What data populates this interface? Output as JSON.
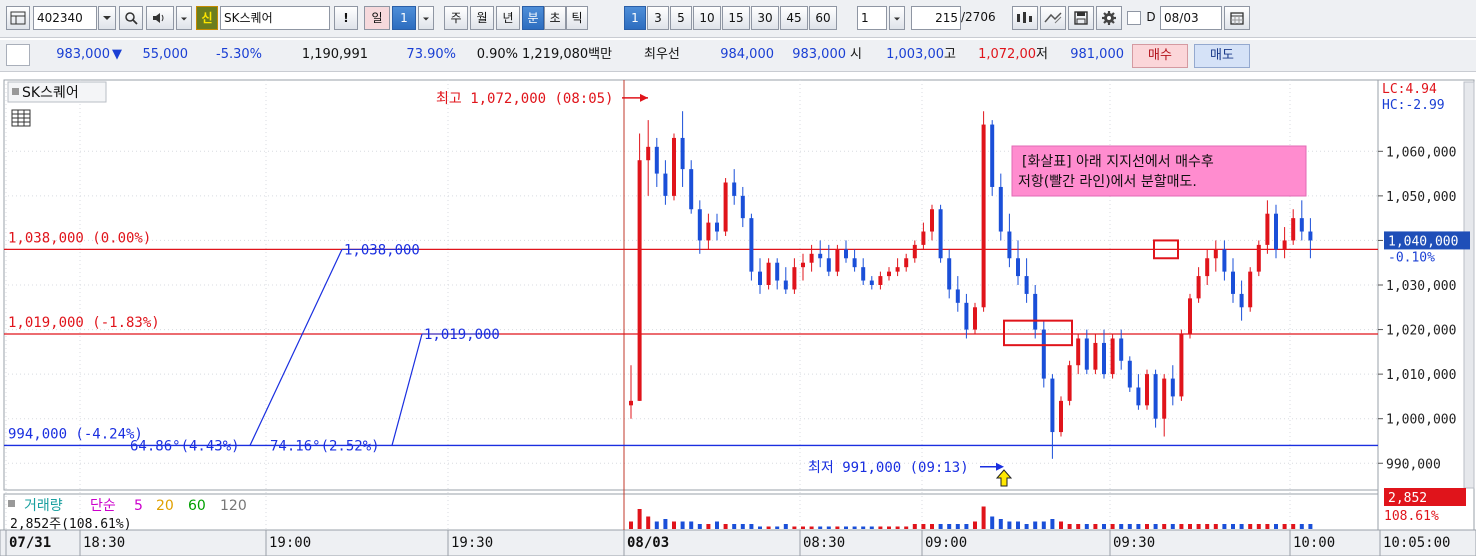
{
  "toolbar": {
    "stock_code": "402340",
    "new_badge": "신",
    "stock_name": "SK스퀘어",
    "exclaim": "!",
    "period_day": "일",
    "period_count": "1",
    "tabs": [
      "주",
      "월",
      "년",
      "분",
      "초",
      "틱"
    ],
    "selected_tab": "분",
    "intervals": [
      "1",
      "3",
      "5",
      "10",
      "15",
      "30",
      "45",
      "60"
    ],
    "selected_interval": "1",
    "interval_value": "1",
    "record_count": "215",
    "record_total": "/2706",
    "date_check_label": "D",
    "date_value": "08/03",
    "icons": [
      "chart-type-icon",
      "search-icon",
      "sound-icon",
      "bar-pattern-icon",
      "crosshair-icon",
      "save-icon",
      "settings-icon",
      "calendar-icon"
    ]
  },
  "quote": {
    "price": "983,000",
    "change_arrow": "▼",
    "change": "55,000",
    "change_pct": "-5.30%",
    "volume": "1,190,991",
    "vol_ratio": "73.90%",
    "turnover": "0.90%",
    "trade_value": "1,219,080백만",
    "best_label": "최우선",
    "best_ask": "984,000",
    "best_bid": "983,000",
    "open_label": "시",
    "open": "1,003,00",
    "high_label": "고",
    "high": "1,072,00",
    "low_label": "저",
    "low": "981,000",
    "buy_button": "매수",
    "sell_button": "매도"
  },
  "chart_data": {
    "type": "candlestick",
    "title": "SK스퀘어",
    "interval": "1분",
    "ylim": [
      984000,
      1076000
    ],
    "y_ticks": [
      990000,
      1000000,
      1010000,
      1020000,
      1030000,
      1040000,
      1050000,
      1060000
    ],
    "y_tick_labels": [
      "990,000",
      "1,000,000",
      "1,010,000",
      "1,020,000",
      "1,030,000",
      "1,040,000",
      "1,050,000",
      "1,060,000"
    ],
    "x_ticks": [
      "07/31",
      "18:30",
      "19:00",
      "19:30",
      "08/03",
      "08:30",
      "09:00",
      "09:30",
      "10:00",
      "10:05:00"
    ],
    "corner_labels": {
      "lc": "LC:4.94",
      "hc": "HC:-2.99"
    },
    "last_price": {
      "value": 1040000,
      "label": "1,040,000",
      "pct": "-0.10%"
    },
    "hlines": [
      {
        "value": 1038000,
        "label": "1,038,000 (0.00%)",
        "color": "#e0141b"
      },
      {
        "value": 1019000,
        "label": "1,019,000 (-1.83%)",
        "color": "#e0141b"
      },
      {
        "value": 994000,
        "label": "994,000 (-4.24%)",
        "color": "#1a2fe0"
      }
    ],
    "trendlines": [
      {
        "value_label": "1,038,000",
        "angle_label": "64.86°(4.43%)"
      },
      {
        "value_label": "1,019,000",
        "angle_label": "74.16°(2.52%)"
      }
    ],
    "annotations": {
      "high_label": "최고 1,072,000 (08:05)",
      "low_label": "최저 991,000 (09:13)",
      "note_line1": "[화살표] 아래 지지선에서 매수후",
      "note_line2": "저항(빨간 라인)에서 분할매도."
    },
    "candles": [
      [
        1003000,
        1012000,
        1000000,
        1004000
      ],
      [
        1004000,
        1064000,
        1004000,
        1058000
      ],
      [
        1058000,
        1067000,
        1050000,
        1061000
      ],
      [
        1061000,
        1063000,
        1052000,
        1055000
      ],
      [
        1055000,
        1058000,
        1048000,
        1050000
      ],
      [
        1050000,
        1064000,
        1049000,
        1063000
      ],
      [
        1063000,
        1069000,
        1052000,
        1056000
      ],
      [
        1056000,
        1058000,
        1046000,
        1047000
      ],
      [
        1047000,
        1049000,
        1037000,
        1040000
      ],
      [
        1040000,
        1046000,
        1038000,
        1044000
      ],
      [
        1044000,
        1046000,
        1040000,
        1042000
      ],
      [
        1042000,
        1054000,
        1041000,
        1053000
      ],
      [
        1053000,
        1056000,
        1048000,
        1050000
      ],
      [
        1050000,
        1052000,
        1043000,
        1045000
      ],
      [
        1045000,
        1046000,
        1031000,
        1033000
      ],
      [
        1033000,
        1036000,
        1028000,
        1030000
      ],
      [
        1030000,
        1036000,
        1029000,
        1035000
      ],
      [
        1035000,
        1036000,
        1029000,
        1031000
      ],
      [
        1031000,
        1034000,
        1028000,
        1029000
      ],
      [
        1029000,
        1036000,
        1028000,
        1034000
      ],
      [
        1034000,
        1037000,
        1031000,
        1035000
      ],
      [
        1035000,
        1039000,
        1033000,
        1037000
      ],
      [
        1037000,
        1040000,
        1034000,
        1036000
      ],
      [
        1036000,
        1039000,
        1032000,
        1033000
      ],
      [
        1033000,
        1039000,
        1032000,
        1038000
      ],
      [
        1038000,
        1040000,
        1035000,
        1036000
      ],
      [
        1036000,
        1038000,
        1033000,
        1034000
      ],
      [
        1034000,
        1036000,
        1030000,
        1031000
      ],
      [
        1031000,
        1032000,
        1029000,
        1030000
      ],
      [
        1030000,
        1033000,
        1029000,
        1032000
      ],
      [
        1032000,
        1034000,
        1031000,
        1033000
      ],
      [
        1033000,
        1036000,
        1032000,
        1034000
      ],
      [
        1034000,
        1037000,
        1033000,
        1036000
      ],
      [
        1036000,
        1040000,
        1035000,
        1039000
      ],
      [
        1039000,
        1044000,
        1038000,
        1042000
      ],
      [
        1042000,
        1048000,
        1040000,
        1047000
      ],
      [
        1047000,
        1048000,
        1035000,
        1036000
      ],
      [
        1036000,
        1038000,
        1027000,
        1029000
      ],
      [
        1029000,
        1032000,
        1024000,
        1026000
      ],
      [
        1026000,
        1028000,
        1018000,
        1020000
      ],
      [
        1020000,
        1026000,
        1019000,
        1025000
      ],
      [
        1025000,
        1069000,
        1024000,
        1066000
      ],
      [
        1066000,
        1067000,
        1050000,
        1052000
      ],
      [
        1052000,
        1055000,
        1040000,
        1042000
      ],
      [
        1042000,
        1046000,
        1034000,
        1036000
      ],
      [
        1036000,
        1040000,
        1030000,
        1032000
      ],
      [
        1032000,
        1036000,
        1026000,
        1028000
      ],
      [
        1028000,
        1030000,
        1018000,
        1020000
      ],
      [
        1020000,
        1022000,
        1007000,
        1009000
      ],
      [
        1009000,
        1010000,
        991000,
        997000
      ],
      [
        997000,
        1005000,
        996000,
        1004000
      ],
      [
        1004000,
        1013000,
        1003000,
        1012000
      ],
      [
        1012000,
        1019000,
        1010000,
        1018000
      ],
      [
        1018000,
        1020000,
        1010000,
        1011000
      ],
      [
        1011000,
        1019000,
        1010000,
        1017000
      ],
      [
        1017000,
        1020000,
        1009000,
        1010000
      ],
      [
        1010000,
        1019000,
        1009000,
        1018000
      ],
      [
        1018000,
        1020000,
        1011000,
        1013000
      ],
      [
        1013000,
        1014000,
        1006000,
        1007000
      ],
      [
        1007000,
        1010000,
        1002000,
        1003000
      ],
      [
        1003000,
        1011000,
        1002000,
        1010000
      ],
      [
        1010000,
        1011000,
        998000,
        1000000
      ],
      [
        1000000,
        1010000,
        996000,
        1009000
      ],
      [
        1009000,
        1012000,
        1003000,
        1005000
      ],
      [
        1005000,
        1020000,
        1004000,
        1019000
      ],
      [
        1019000,
        1028000,
        1018000,
        1027000
      ],
      [
        1027000,
        1034000,
        1026000,
        1032000
      ],
      [
        1032000,
        1038000,
        1030000,
        1036000
      ],
      [
        1036000,
        1040000,
        1033000,
        1038000
      ],
      [
        1038000,
        1040000,
        1031000,
        1033000
      ],
      [
        1033000,
        1036000,
        1026000,
        1028000
      ],
      [
        1028000,
        1031000,
        1022000,
        1025000
      ],
      [
        1025000,
        1034000,
        1024000,
        1033000
      ],
      [
        1033000,
        1040000,
        1032000,
        1039000
      ],
      [
        1039000,
        1049000,
        1037000,
        1046000
      ],
      [
        1046000,
        1048000,
        1036000,
        1038000
      ],
      [
        1038000,
        1043000,
        1036000,
        1040000
      ],
      [
        1040000,
        1047000,
        1039000,
        1045000
      ],
      [
        1045000,
        1049000,
        1040000,
        1042000
      ],
      [
        1042000,
        1045000,
        1036000,
        1040000
      ]
    ],
    "volume": {
      "label": "거래량",
      "ma_label": "단순",
      "ma_periods": [
        "5",
        "20",
        "60",
        "120"
      ],
      "current": "2,852주(108.61%)",
      "right_value": "2,852",
      "right_pct": "108.61%",
      "bars": [
        3,
        8,
        5,
        3,
        4,
        3,
        3,
        3,
        2,
        2,
        3,
        2,
        2,
        2,
        2,
        1,
        1,
        1,
        2,
        1,
        1,
        1,
        1,
        1,
        1,
        1,
        1,
        1,
        1,
        1,
        1,
        1,
        1,
        2,
        2,
        2,
        2,
        2,
        2,
        2,
        3,
        9,
        5,
        4,
        3,
        3,
        2,
        3,
        3,
        4,
        3,
        2,
        2,
        2,
        2,
        2,
        2,
        2,
        2,
        2,
        2,
        2,
        2,
        2,
        2,
        2,
        2,
        2,
        2,
        2,
        2,
        2,
        2,
        2,
        2,
        2,
        2,
        2,
        2,
        2
      ]
    }
  }
}
